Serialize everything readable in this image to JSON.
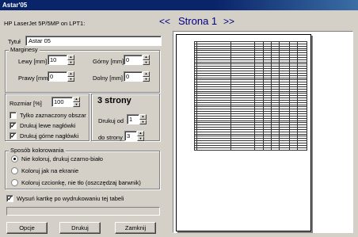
{
  "window": {
    "title": "Astar'05"
  },
  "printer": "HP LaserJet 5P/5MP on LPT1:",
  "nav": {
    "prev": "<<",
    "page_title": "Strona 1",
    "next": ">>"
  },
  "title_field": {
    "label": "Tytuł",
    "value": "Astar 05"
  },
  "margins": {
    "group_label": "Marginesy",
    "left_label": "Lewy [mm]",
    "left_value": "10",
    "top_label": "Górny [mm]",
    "top_value": "0",
    "right_label": "Prawy [mm]",
    "right_value": "0",
    "bottom_label": "Dolny [mm]",
    "bottom_value": "0"
  },
  "size": {
    "label": "Rozmiar [%]",
    "value": "100"
  },
  "options": {
    "selected_only": {
      "label": "Tylko zaznaczony obszar",
      "checked": false
    },
    "left_headers": {
      "label": "Drukuj lewe nagłówki",
      "checked": true
    },
    "top_headers": {
      "label": "Drukuj górne nagłówki",
      "checked": true
    }
  },
  "pages": {
    "count_label": "3 strony",
    "from_label": "Drukuj od",
    "from_value": "1",
    "to_label": "do strony",
    "to_value": "3"
  },
  "coloring": {
    "group_label": "Sposób kolorowania",
    "options": [
      {
        "label": "Nie koloruj, drukuj czarno-biało",
        "selected": true
      },
      {
        "label": "Koloruj jak na ekranie",
        "selected": false
      },
      {
        "label": "Koloruj czcionkę, nie tło (oszczędzaj barwnik)",
        "selected": false
      }
    ]
  },
  "eject": {
    "label": "Wysuń kartkę po wydrukowaniu tej tabeli",
    "checked": true
  },
  "buttons": {
    "options": "Opcje",
    "print": "Drukuj",
    "close": "Zamknij"
  },
  "colors": {
    "face": "#d4d0c8",
    "title_bar": "#0a246a",
    "nav": "#000080"
  },
  "icons": {
    "spin_up": "triangle-up",
    "spin_down": "triangle-down",
    "check": "check-mark"
  }
}
